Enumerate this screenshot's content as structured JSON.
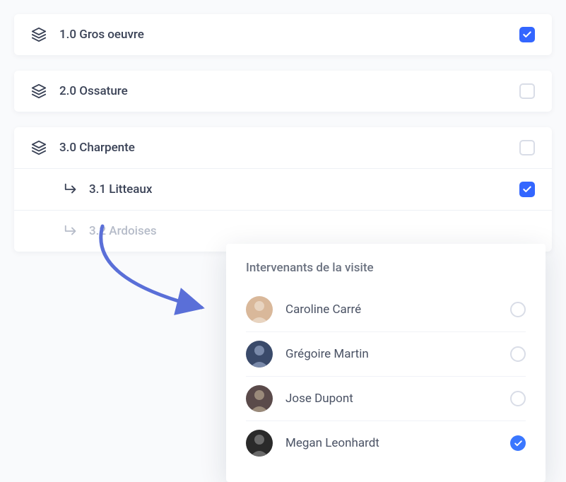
{
  "categories": [
    {
      "number": "1.0",
      "name": "Gros oeuvre",
      "checked": true,
      "children": []
    },
    {
      "number": "2.0",
      "name": "Ossature",
      "checked": false,
      "children": []
    },
    {
      "number": "3.0",
      "name": "Charpente",
      "checked": false,
      "children": [
        {
          "number": "3.1",
          "name": "Litteaux",
          "checked": true,
          "faded": false
        },
        {
          "number": "3.2",
          "name": "Ardoises",
          "checked": null,
          "faded": true
        }
      ]
    }
  ],
  "popup": {
    "title": "Intervenants de la visite",
    "people": [
      {
        "name": "Caroline  Carré",
        "selected": false,
        "avatar_bg": "#d9b89a"
      },
      {
        "name": "Grégoire Martin",
        "selected": false,
        "avatar_bg": "#3a4a6a"
      },
      {
        "name": "Jose Dupont",
        "selected": false,
        "avatar_bg": "#5a4a4a"
      },
      {
        "name": "Megan Leonhardt",
        "selected": true,
        "avatar_bg": "#2a2a2a"
      }
    ]
  },
  "colors": {
    "accent": "#3366ff",
    "arrow": "#5a6fd8"
  }
}
